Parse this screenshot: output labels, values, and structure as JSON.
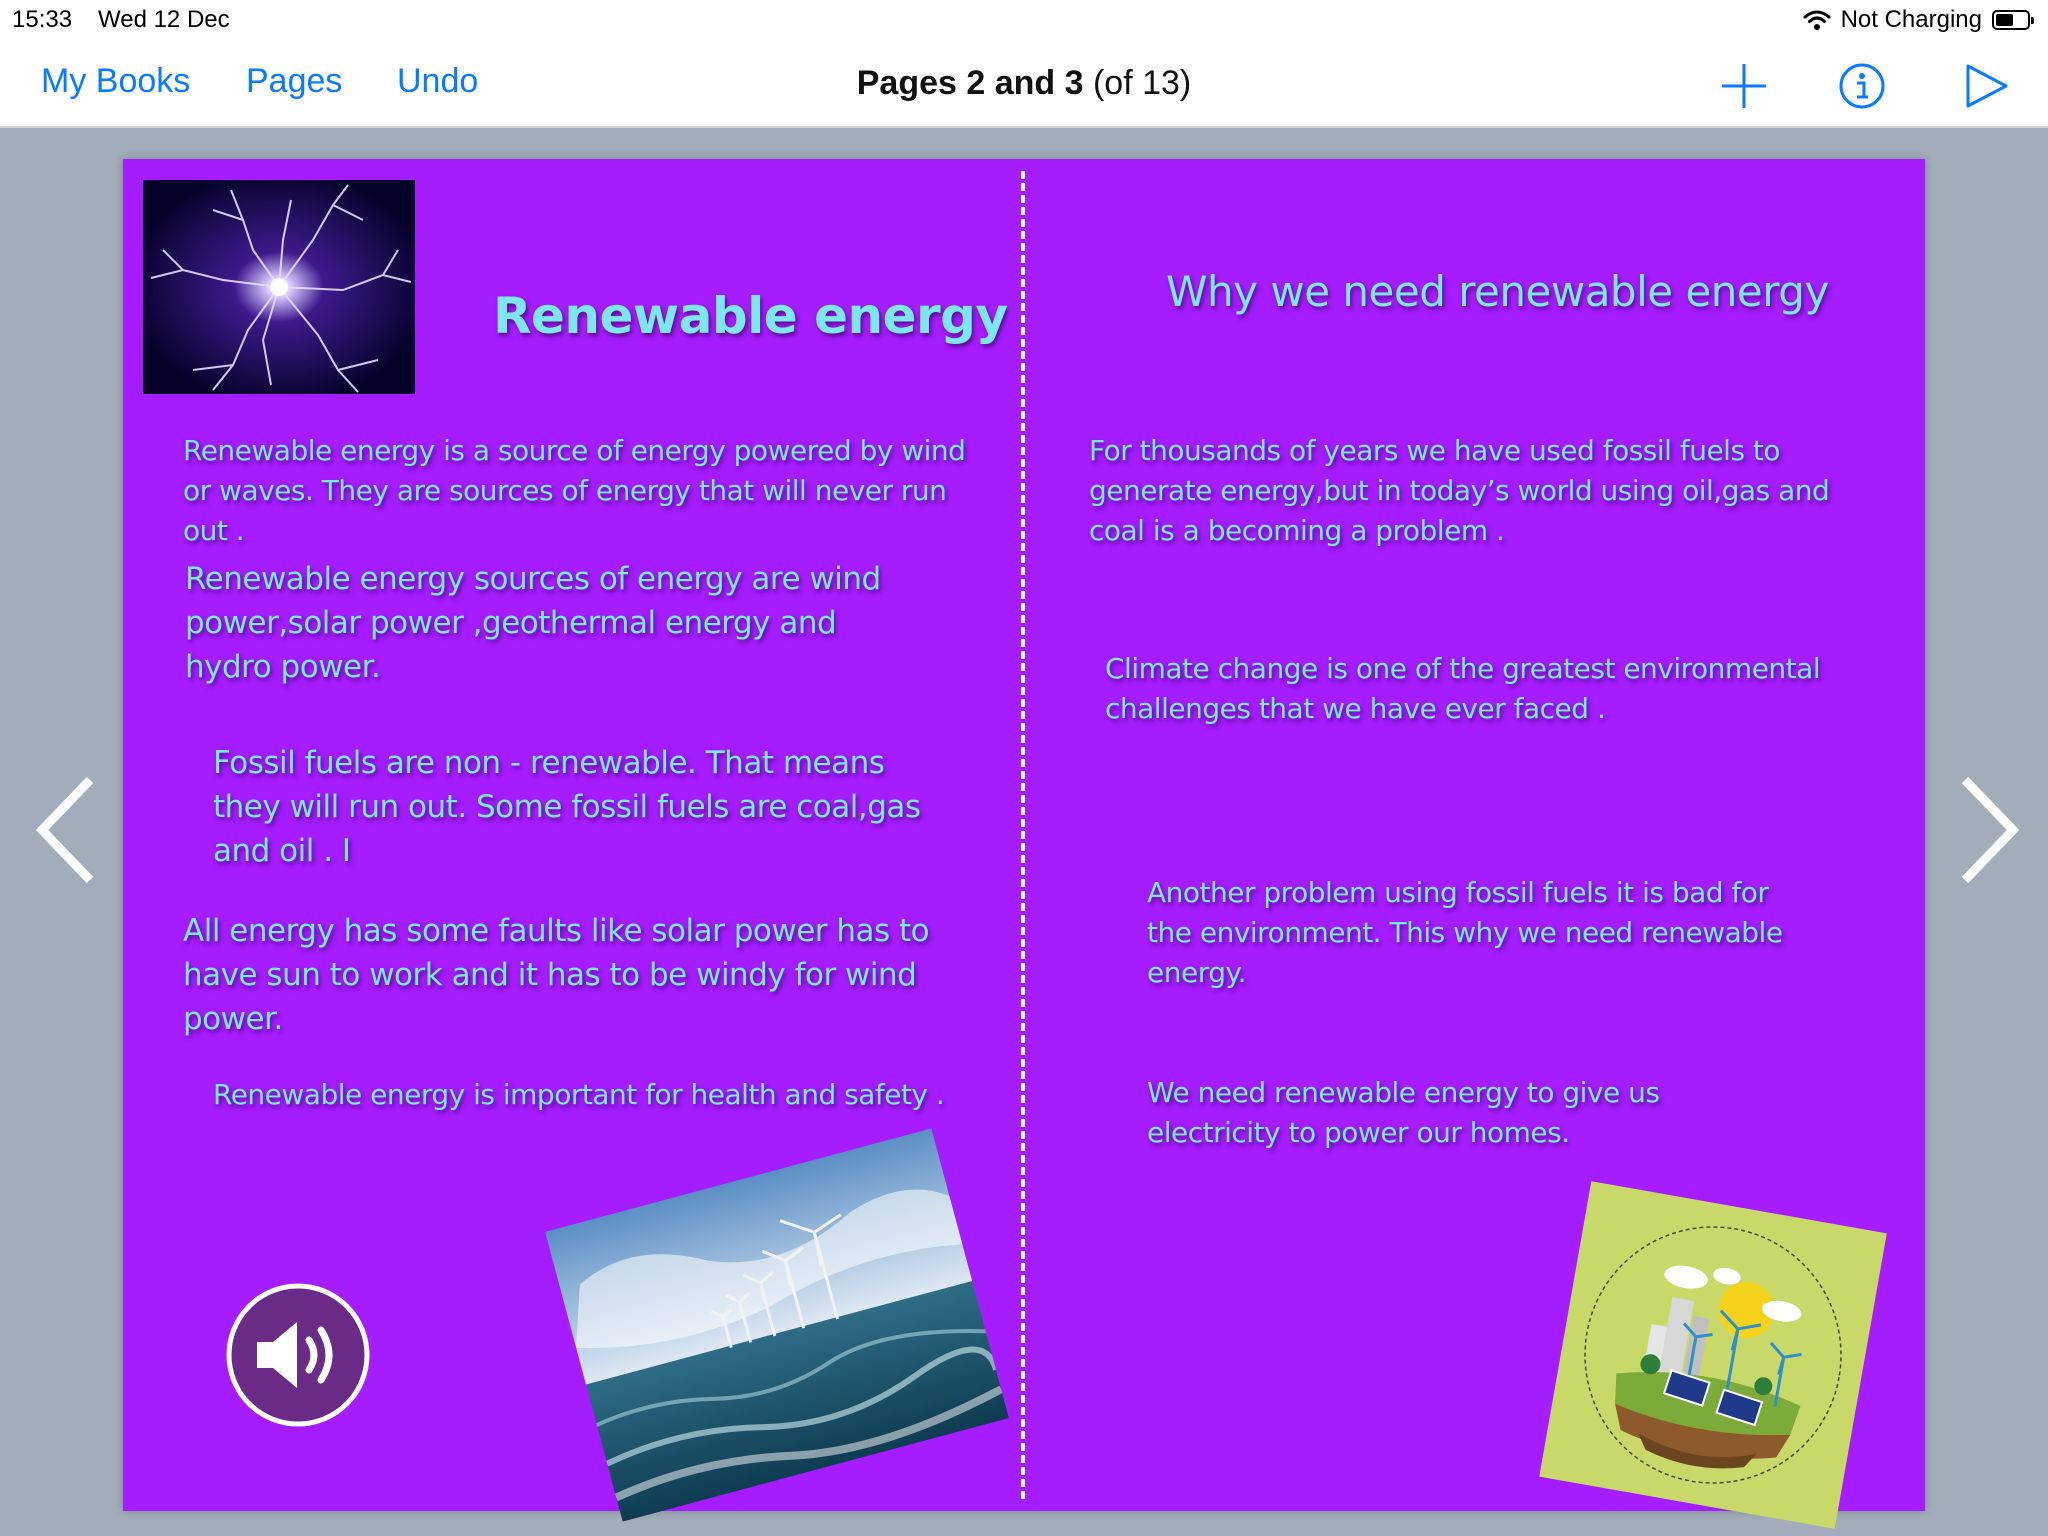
{
  "status_bar": {
    "time": "15:33",
    "date": "Wed 12 Dec",
    "battery_label": "Not Charging",
    "battery_level": 0.55,
    "wifi_icon": "wifi-icon"
  },
  "nav": {
    "my_books": "My Books",
    "pages": "Pages",
    "undo": "Undo",
    "title_main": "Pages 2 and 3",
    "title_sub": "(of 13)",
    "icons": [
      "add-icon",
      "info-icon",
      "play-icon"
    ]
  },
  "colors": {
    "accent": "#0a7aff",
    "background": "#a2adb9",
    "page": "#a51cff",
    "text": "#7ce7f0"
  },
  "left_page": {
    "title": "Renewable energy",
    "paragraphs": [
      "Renewable energy is a source of energy powered by wind  or waves. They are sources of energy that will never run out .",
      "Renewable energy sources of energy are wind power,solar power ,geothermal energy and hydro power.",
      "Fossil fuels are non - renewable. That means they will run out. Some fossil fuels are coal,gas and oil . I",
      "All energy has some faults like solar power has to have sun to work and it has to be windy for wind power.",
      "Renewable energy is important for health and safety ."
    ],
    "images": [
      "lightning-image",
      "wind-turbines-sea-image"
    ],
    "audio_icon": "speaker-icon"
  },
  "right_page": {
    "title": "Why we need renewable energy",
    "paragraphs": [
      "For thousands of years we have used fossil fuels to generate energy,but in today’s world using oil,gas and coal is a becoming a problem .",
      "Climate change is one of the greatest environmental challenges that we have ever faced .",
      "Another problem using fossil fuels it is bad for the environment. This why we need renewable energy.",
      "We need renewable energy to give us electricity to power our homes."
    ],
    "images": [
      "eco-city-illustration"
    ]
  }
}
